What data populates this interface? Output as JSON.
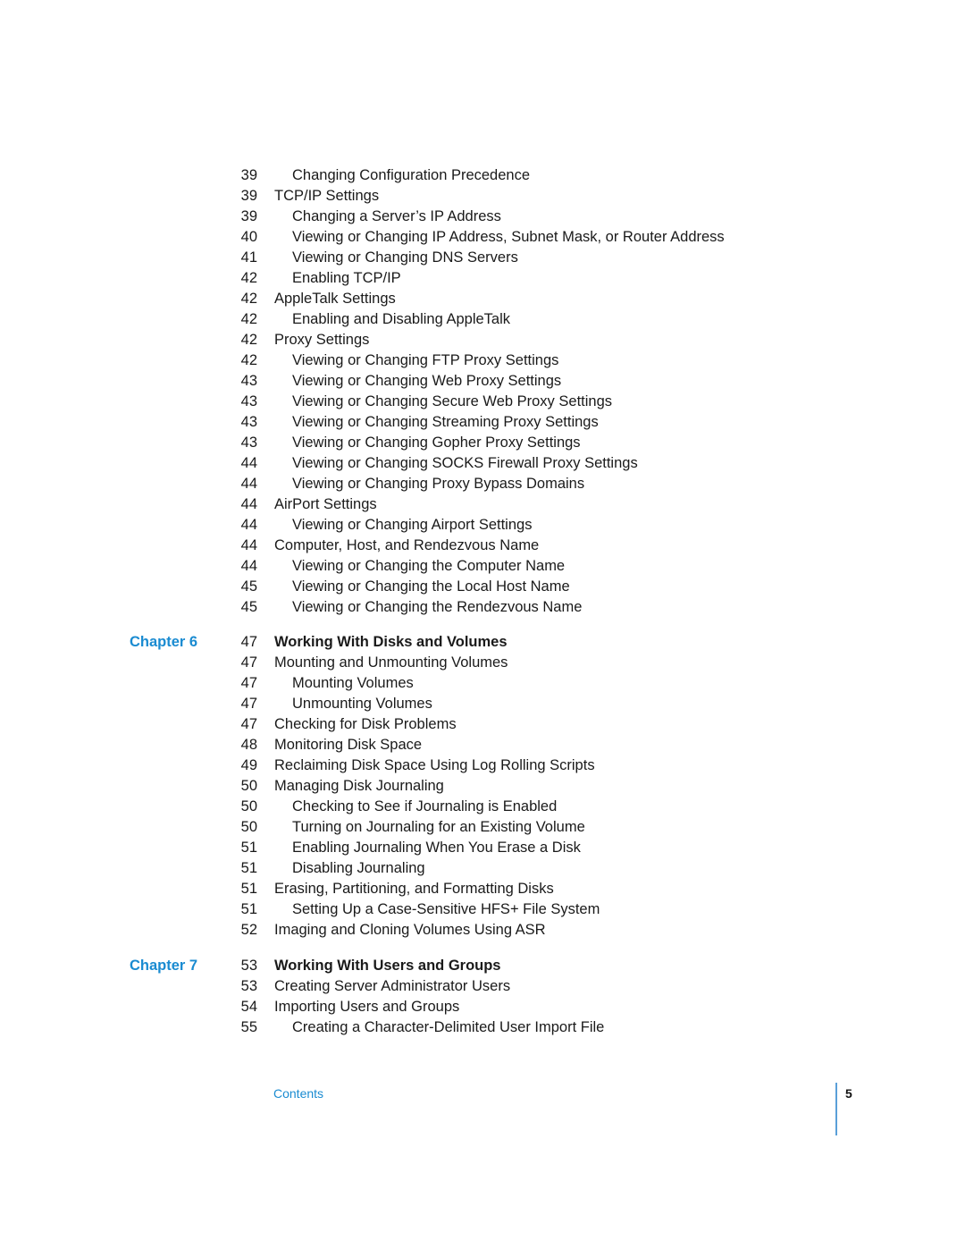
{
  "toc_part1": [
    {
      "page": "39",
      "title": "Changing Configuration Precedence",
      "level": 2
    },
    {
      "page": "39",
      "title": "TCP/IP Settings",
      "level": 1
    },
    {
      "page": "39",
      "title": "Changing a Server’s IP Address",
      "level": 2
    },
    {
      "page": "40",
      "title": "Viewing or Changing IP Address, Subnet Mask, or Router Address",
      "level": 2
    },
    {
      "page": "41",
      "title": "Viewing or Changing DNS Servers",
      "level": 2
    },
    {
      "page": "42",
      "title": "Enabling TCP/IP",
      "level": 2
    },
    {
      "page": "42",
      "title": "AppleTalk Settings",
      "level": 1
    },
    {
      "page": "42",
      "title": "Enabling and Disabling AppleTalk",
      "level": 2
    },
    {
      "page": "42",
      "title": "Proxy Settings",
      "level": 1
    },
    {
      "page": "42",
      "title": "Viewing or Changing FTP Proxy Settings",
      "level": 2
    },
    {
      "page": "43",
      "title": "Viewing or Changing Web Proxy Settings",
      "level": 2
    },
    {
      "page": "43",
      "title": "Viewing or Changing Secure Web Proxy Settings",
      "level": 2
    },
    {
      "page": "43",
      "title": "Viewing or Changing Streaming Proxy Settings",
      "level": 2
    },
    {
      "page": "43",
      "title": "Viewing or Changing Gopher Proxy Settings",
      "level": 2
    },
    {
      "page": "44",
      "title": "Viewing or Changing SOCKS Firewall Proxy Settings",
      "level": 2
    },
    {
      "page": "44",
      "title": "Viewing or Changing Proxy Bypass Domains",
      "level": 2
    },
    {
      "page": "44",
      "title": "AirPort Settings",
      "level": 1
    },
    {
      "page": "44",
      "title": "Viewing or Changing Airport Settings",
      "level": 2
    },
    {
      "page": "44",
      "title": "Computer, Host, and Rendezvous Name",
      "level": 1
    },
    {
      "page": "44",
      "title": "Viewing or Changing the Computer Name",
      "level": 2
    },
    {
      "page": "45",
      "title": "Viewing or Changing the Local Host Name",
      "level": 2
    },
    {
      "page": "45",
      "title": "Viewing or Changing the Rendezvous Name",
      "level": 2
    }
  ],
  "chapter6": {
    "label": "Chapter 6",
    "entries": [
      {
        "page": "47",
        "title": "Working With Disks and Volumes",
        "level": 0
      },
      {
        "page": "47",
        "title": "Mounting and Unmounting Volumes",
        "level": 1
      },
      {
        "page": "47",
        "title": "Mounting Volumes",
        "level": 2
      },
      {
        "page": "47",
        "title": "Unmounting Volumes",
        "level": 2
      },
      {
        "page": "47",
        "title": "Checking for Disk Problems",
        "level": 1
      },
      {
        "page": "48",
        "title": "Monitoring Disk Space",
        "level": 1
      },
      {
        "page": "49",
        "title": "Reclaiming Disk Space Using Log Rolling Scripts",
        "level": 1
      },
      {
        "page": "50",
        "title": "Managing Disk Journaling",
        "level": 1
      },
      {
        "page": "50",
        "title": "Checking to See if Journaling is Enabled",
        "level": 2
      },
      {
        "page": "50",
        "title": "Turning on Journaling for an Existing Volume",
        "level": 2
      },
      {
        "page": "51",
        "title": "Enabling Journaling When You Erase a Disk",
        "level": 2
      },
      {
        "page": "51",
        "title": "Disabling Journaling",
        "level": 2
      },
      {
        "page": "51",
        "title": "Erasing, Partitioning, and Formatting Disks",
        "level": 1
      },
      {
        "page": "51",
        "title": "Setting Up a Case-Sensitive HFS+ File System",
        "level": 2
      },
      {
        "page": "52",
        "title": "Imaging and Cloning Volumes Using ASR",
        "level": 1
      }
    ]
  },
  "chapter7": {
    "label": "Chapter 7",
    "entries": [
      {
        "page": "53",
        "title": "Working With Users and Groups",
        "level": 0
      },
      {
        "page": "53",
        "title": "Creating Server Administrator Users",
        "level": 1
      },
      {
        "page": "54",
        "title": "Importing Users and Groups",
        "level": 1
      },
      {
        "page": "55",
        "title": "Creating a Character-Delimited User Import File",
        "level": 2
      }
    ]
  },
  "footer": {
    "section": "Contents",
    "page_number": "5"
  },
  "colors": {
    "accent": "#1a8bd1",
    "text": "#1a1a1a"
  }
}
